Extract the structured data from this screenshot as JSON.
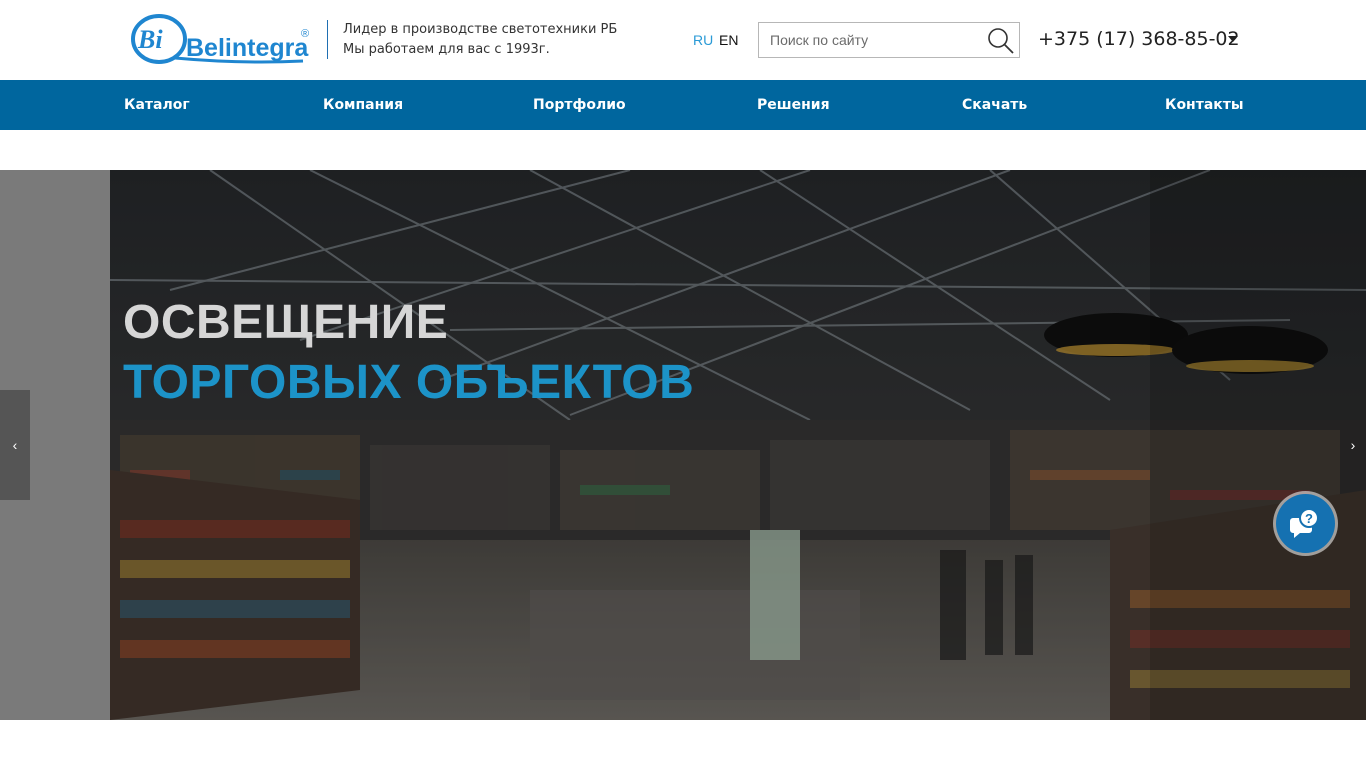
{
  "colors": {
    "brand_blue": "#1f86d0",
    "nav_bg": "#00669e",
    "lang_active": "#2a9ad6",
    "headline_white": "#d9d9d9",
    "headline_blue": "#1c93c8",
    "chat_bg": "#1571b1"
  },
  "header": {
    "logo_icon": "Bi",
    "logo_text": "Belintegra",
    "logo_mark": "®",
    "tagline_line1": "Лидер в производстве светотехники РБ",
    "tagline_line2": "Мы работаем для вас с 1993г.",
    "lang_ru": "RU",
    "lang_en": "EN",
    "search_placeholder": "Поиск по сайту",
    "search_icon": "search-icon",
    "phone": "+375 (17) 368-85-02",
    "phone_dropdown_icon": "caret-down-icon"
  },
  "nav": {
    "items": [
      {
        "label": "Каталог"
      },
      {
        "label": "Компания"
      },
      {
        "label": "Портфолио"
      },
      {
        "label": "Решения"
      },
      {
        "label": "Скачать"
      },
      {
        "label": "Контакты"
      }
    ]
  },
  "slider": {
    "headline_line1": "ОСВЕЩЕНИЕ",
    "headline_line2": "ТОРГОВЫХ ОБЪЕКТОВ",
    "prev_label": "‹",
    "next_label": "›",
    "chat_icon": "chat-help-icon"
  }
}
